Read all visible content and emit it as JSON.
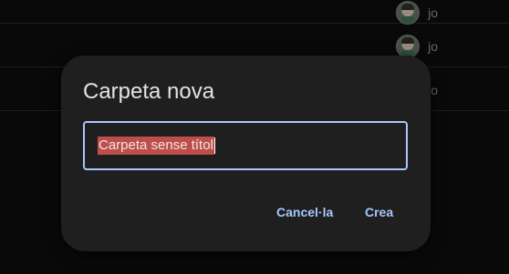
{
  "file_list": {
    "rows": [
      {
        "owner": "jo"
      },
      {
        "owner": "jo"
      },
      {
        "owner": "jo"
      }
    ]
  },
  "dialog": {
    "title": "Carpeta nova",
    "input": {
      "value": "Carpeta sense títol",
      "selected": true
    },
    "buttons": {
      "cancel": "Cancel·la",
      "create": "Crea"
    }
  },
  "colors": {
    "accent": "#a8c7fa",
    "dialog_bg": "#1f1f1f",
    "selection": "#bd4e4a"
  }
}
